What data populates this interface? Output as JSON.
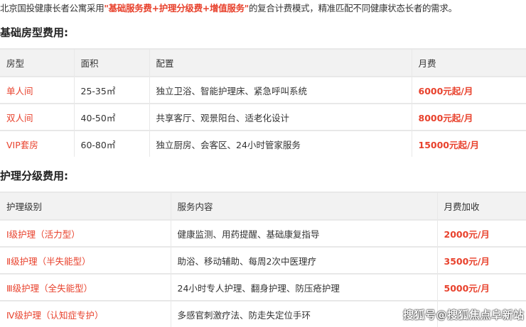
{
  "intro": {
    "before": "北京国投健康长者公寓采用",
    "highlight": "\"基础服务费+护理分级费+增值服务\"",
    "after": "的复合计费模式，精准匹配不同健康状态长者的需求。"
  },
  "room_section": {
    "title": "基础房型费用:",
    "headers": [
      "房型",
      "面积",
      "配置",
      "月费"
    ],
    "rows": [
      {
        "type": "单人间",
        "area": "25-35㎡",
        "config": "独立卫浴、智能护理床、紧急呼叫系统",
        "fee": "6000元起/月"
      },
      {
        "type": "双人间",
        "area": "40-50㎡",
        "config": "共享客厅、观景阳台、适老化设计",
        "fee": "8000元起/月"
      },
      {
        "type": "VIP套房",
        "area": "60-80㎡",
        "config": "独立厨房、会客区、24小时管家服务",
        "fee": "15000元起/月"
      }
    ]
  },
  "care_section": {
    "title": "护理分级费用:",
    "headers": [
      "护理级别",
      "服务内容",
      "月费加收"
    ],
    "rows": [
      {
        "level": "Ⅰ级护理（活力型）",
        "service": "健康监测、用药提醒、基础康复指导",
        "fee": "2000元/月"
      },
      {
        "level": "Ⅱ级护理（半失能型）",
        "service": "助浴、移动辅助、每周2次中医理疗",
        "fee": "3500元/月"
      },
      {
        "level": "Ⅲ级护理（全失能型）",
        "service": "24小时专人护理、翻身护理、防压疮护理",
        "fee": "5000元/月"
      },
      {
        "level": "Ⅳ级护理（认知症专护）",
        "service": "多感官刺激疗法、防走失定位手环",
        "fee": ""
      }
    ]
  },
  "watermark": "搜狐号@搜狐焦点阜新站"
}
